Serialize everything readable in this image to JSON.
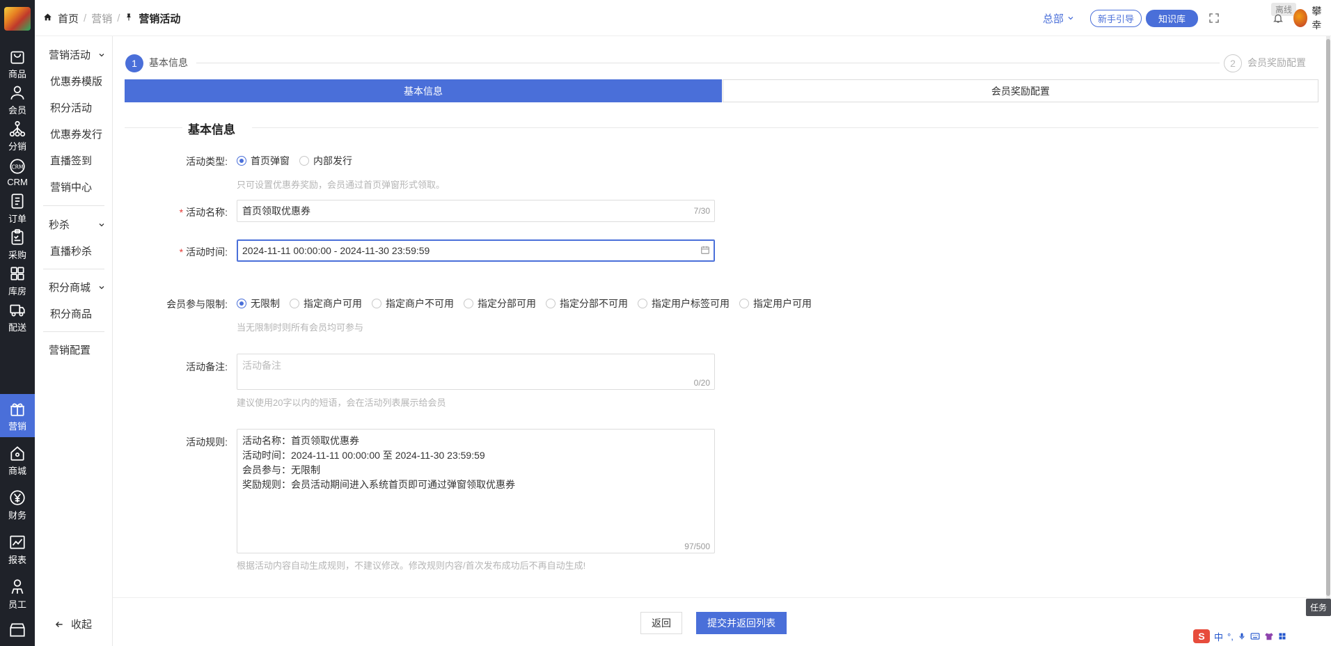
{
  "rail": {
    "items": [
      {
        "label": "商品",
        "icon": "bag-icon"
      },
      {
        "label": "会员",
        "icon": "user-icon"
      },
      {
        "label": "分销",
        "icon": "network-icon"
      },
      {
        "label": "CRM",
        "icon": "crm-icon"
      },
      {
        "label": "订单",
        "icon": "order-icon"
      },
      {
        "label": "采购",
        "icon": "clipboard-icon"
      },
      {
        "label": "库房",
        "icon": "warehouse-icon"
      },
      {
        "label": "配送",
        "icon": "truck-icon"
      },
      {
        "label": "营销",
        "icon": "gift-icon"
      },
      {
        "label": "商城",
        "icon": "home-icon"
      },
      {
        "label": "财务",
        "icon": "yen-icon"
      },
      {
        "label": "报表",
        "icon": "chart-icon"
      },
      {
        "label": "员工",
        "icon": "staff-icon"
      }
    ],
    "active_index": 8
  },
  "topbar": {
    "breadcrumb": [
      "首页",
      "营销",
      "营销活动"
    ],
    "hq": "总部",
    "guide": "新手引导",
    "kb": "知识库",
    "offline": "离线",
    "username": "攀幸"
  },
  "submenu": {
    "groups": [
      {
        "title": "营销活动",
        "items": [
          "优惠券模版",
          "积分活动",
          "优惠券发行",
          "直播签到",
          "营销中心"
        ]
      },
      {
        "title": "秒杀",
        "items": [
          "直播秒杀"
        ]
      },
      {
        "title": "积分商城",
        "items": [
          "积分商品"
        ]
      }
    ],
    "config": "营销配置",
    "collapse": "收起"
  },
  "steps": {
    "step1_num": "1",
    "step1_label": "基本信息",
    "step2_num": "2",
    "step2_label": "会员奖励配置"
  },
  "tabs": [
    "基本信息",
    "会员奖励配置"
  ],
  "section_title": "基本信息",
  "form": {
    "type_label": "活动类型:",
    "type_options": [
      "首页弹窗",
      "内部发行"
    ],
    "type_hint": "只可设置优惠券奖励，会员通过首页弹窗形式领取。",
    "name_label": "活动名称:",
    "name_value": "首页领取优惠券",
    "name_count": "7/30",
    "time_label": "活动时间:",
    "time_value": "2024-11-11 00:00:00 - 2024-11-30 23:59:59",
    "limit_label": "会员参与限制:",
    "limit_options": [
      "无限制",
      "指定商户可用",
      "指定商户不可用",
      "指定分部可用",
      "指定分部不可用",
      "指定用户标签可用",
      "指定用户可用"
    ],
    "limit_hint": "当无限制时则所有会员均可参与",
    "remark_label": "活动备注:",
    "remark_placeholder": "活动备注",
    "remark_count": "0/20",
    "remark_hint": "建议使用20字以内的短语，会在活动列表展示给会员",
    "rule_label": "活动规则:",
    "rule_lines": [
      "活动名称：首页领取优惠券",
      "活动时间：2024-11-11 00:00:00 至 2024-11-30 23:59:59",
      "会员参与：无限制",
      "奖励规则：会员活动期间进入系统首页即可通过弹窗领取优惠券"
    ],
    "rule_count": "97/500",
    "rule_hint": "根据活动内容自动生成规则，不建议修改。修改规则内容/首次发布成功后不再自动生成!"
  },
  "footer": {
    "back": "返回",
    "submit": "提交并返回列表"
  },
  "task": "任务",
  "ime": {
    "logo": "S",
    "lang": "中"
  },
  "colors": {
    "primary": "#4a6fd9",
    "rail": "#1f2229",
    "required": "#e53935"
  }
}
